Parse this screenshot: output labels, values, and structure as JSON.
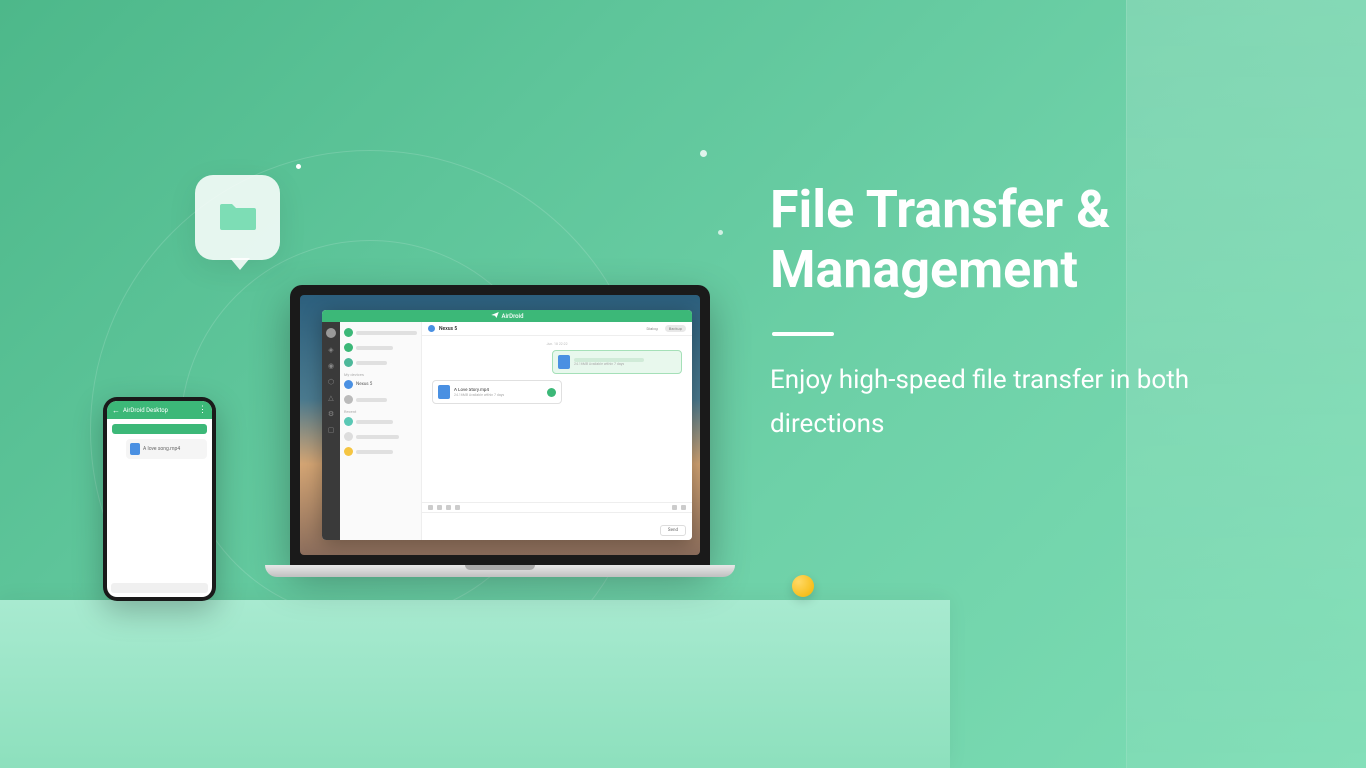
{
  "hero": {
    "title": "File Transfer & Management",
    "subtitle": "Enjoy high-speed file transfer in both directions"
  },
  "app": {
    "brand": "AirDroid"
  },
  "phone": {
    "header_title": "AirDroid Desktop",
    "file_name": "A love song.mp4"
  },
  "laptop_chat": {
    "device_name": "Nexus 5",
    "tab_dialog": "Dialog",
    "tab_backup": "Backup",
    "timestamp": "Jun. 18  22:22",
    "sent_file_meta": "24.16MB   Available within 7 days",
    "recv_file_name": "A Love Story.mp4",
    "recv_file_meta": "24.16MB   Available within 7 days",
    "send_button": "Send",
    "contact_nexus": "Nexus 5",
    "section_my_devices": "My devices",
    "section_recent": "Recent"
  },
  "colors": {
    "accent_green": "#3cb878",
    "contact_green": "#3cb878",
    "contact_teal2": "#4db89a",
    "contact_blue": "#4a90e2",
    "contact_teal": "#5ac8b5",
    "contact_yellow": "#f5c542"
  }
}
